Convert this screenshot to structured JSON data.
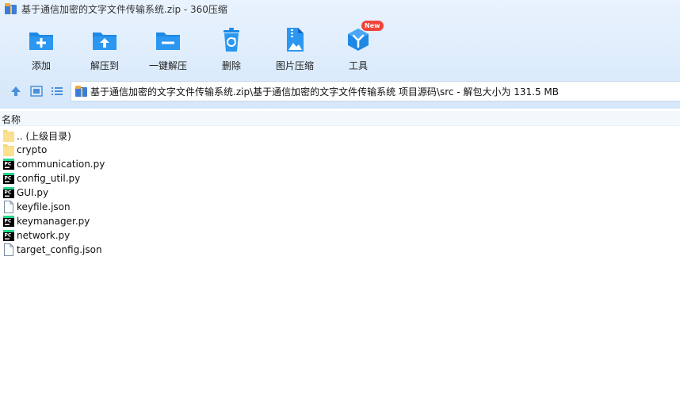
{
  "window": {
    "title": "基于通信加密的文字文件传输系统.zip - 360压缩"
  },
  "toolbar": {
    "add": "添加",
    "extract_to": "解压到",
    "one_click_extract": "一键解压",
    "delete": "删除",
    "image_compress": "图片压缩",
    "tools": "工具",
    "new_badge": "New"
  },
  "address": {
    "path": "基于通信加密的文字文件传输系统.zip\\基于通信加密的文字文件传输系统 项目源码\\src - 解包大小为 131.5 MB"
  },
  "list": {
    "column_name": "名称",
    "items": [
      {
        "name": ".. (上级目录)",
        "type": "folder"
      },
      {
        "name": "crypto",
        "type": "folder"
      },
      {
        "name": "communication.py",
        "type": "python"
      },
      {
        "name": "config_util.py",
        "type": "python"
      },
      {
        "name": "GUI.py",
        "type": "python"
      },
      {
        "name": "keyfile.json",
        "type": "file"
      },
      {
        "name": "keymanager.py",
        "type": "python"
      },
      {
        "name": "network.py",
        "type": "python"
      },
      {
        "name": "target_config.json",
        "type": "file"
      }
    ]
  },
  "colors": {
    "accent": "#1e88e5",
    "badge": "#f04438"
  }
}
